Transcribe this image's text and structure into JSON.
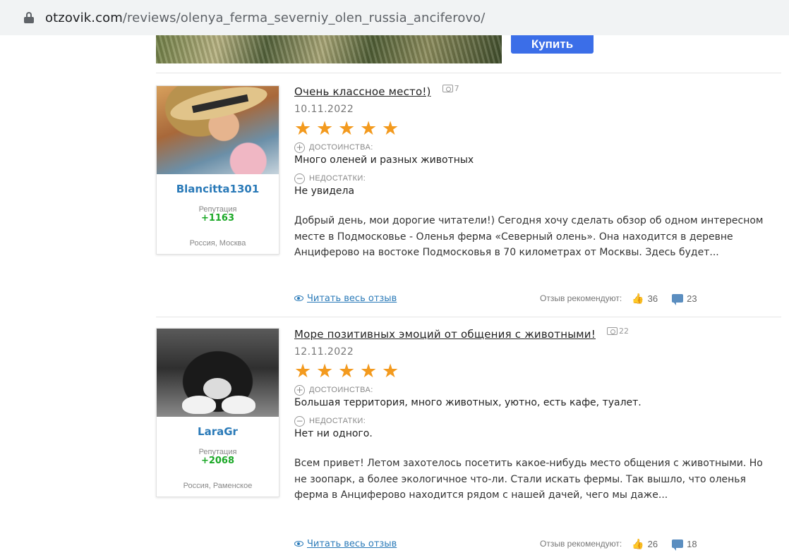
{
  "browser": {
    "url_host": "otzovik.com",
    "url_path": "/reviews/olenya_ferma_severniy_olen_russia_anciferovo/"
  },
  "banner": {
    "buy_label": "Купить"
  },
  "labels": {
    "pros": "ДОСТОИНСТВА:",
    "cons": "НЕДОСТАТКИ:",
    "reputation": "Репутация",
    "read_more": "Читать весь отзыв",
    "recommend": "Отзыв рекомендуют:"
  },
  "reviews": [
    {
      "title": "Очень классное место!)",
      "photo_count": "7",
      "date": "10.11.2022",
      "rating": 5,
      "pros": "Много оленей и разных животных",
      "cons": "Не увидела",
      "body": "Добрый день, мои дорогие читатели!) Сегодня хочу сделать обзор об одном интересном месте в Подмосковье - Оленья ферма «Северный олень». Она находится в деревне Анциферово на востоке Подмосковья в 70 километрах от Москвы. Здесь будет...",
      "user": {
        "name": "Blancitta1301",
        "reputation": "+1163",
        "location": "Россия, Москва"
      },
      "likes": "36",
      "comments": "23"
    },
    {
      "title": "Море позитивных эмоций от общения с животными!",
      "photo_count": "22",
      "date": "12.11.2022",
      "rating": 5,
      "pros": "Большая территория, много животных, уютно, есть кафе, туалет.",
      "cons": "Нет ни одного.",
      "body": "Всем привет! Летом захотелось посетить какое-нибудь место общения с животными. Но не зоопарк, а более экологичное что-ли. Стали искать фермы. Так вышло, что оленья ферма в Анциферово находится рядом с нашей дачей, чего мы даже...",
      "user": {
        "name": "LaraGr",
        "reputation": "+2068",
        "location": "Россия, Раменское"
      },
      "likes": "26",
      "comments": "18"
    }
  ],
  "colors": {
    "star": "#f39a1e",
    "link": "#2a7ab8",
    "reputation": "#1aa826",
    "buy_button": "#3b6ee8"
  }
}
